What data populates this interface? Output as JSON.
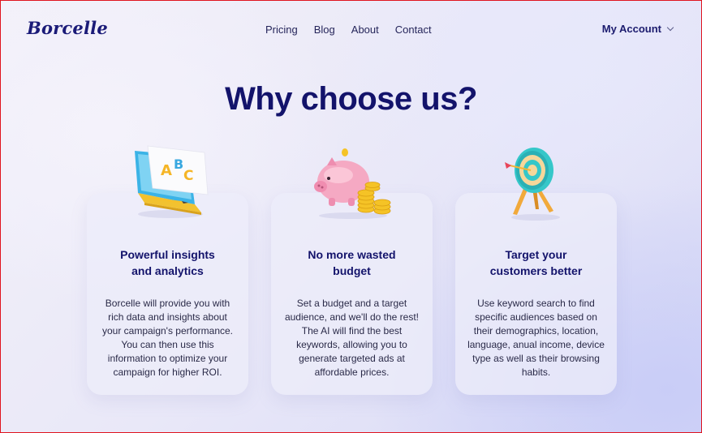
{
  "header": {
    "logo": "Borcelle",
    "nav": [
      "Pricing",
      "Blog",
      "About",
      "Contact"
    ],
    "account": "My Account"
  },
  "hero": {
    "title": "Why choose us?"
  },
  "features": [
    {
      "title_line1": "Powerful insights",
      "title_line2": "and analytics",
      "body": "Borcelle will provide you with rich data and insights about your campaign's performance. You can then use this information to optimize your campaign for higher ROI.",
      "icon": "laptop-abc-icon"
    },
    {
      "title_line1": "No more wasted",
      "title_line2": "budget",
      "body": "Set a budget and a target audience, and we'll do the rest! The AI will find the best keywords, allowing you to generate targeted ads at affordable prices.",
      "icon": "piggy-bank-icon"
    },
    {
      "title_line1": "Target your",
      "title_line2": "customers better",
      "body": "Use keyword search to find specific audiences based on their demographics, location, language, anual income, device type as well as their browsing habits.",
      "icon": "target-icon"
    }
  ],
  "illustration_text": {
    "letters": [
      "A",
      "B",
      "C"
    ]
  }
}
